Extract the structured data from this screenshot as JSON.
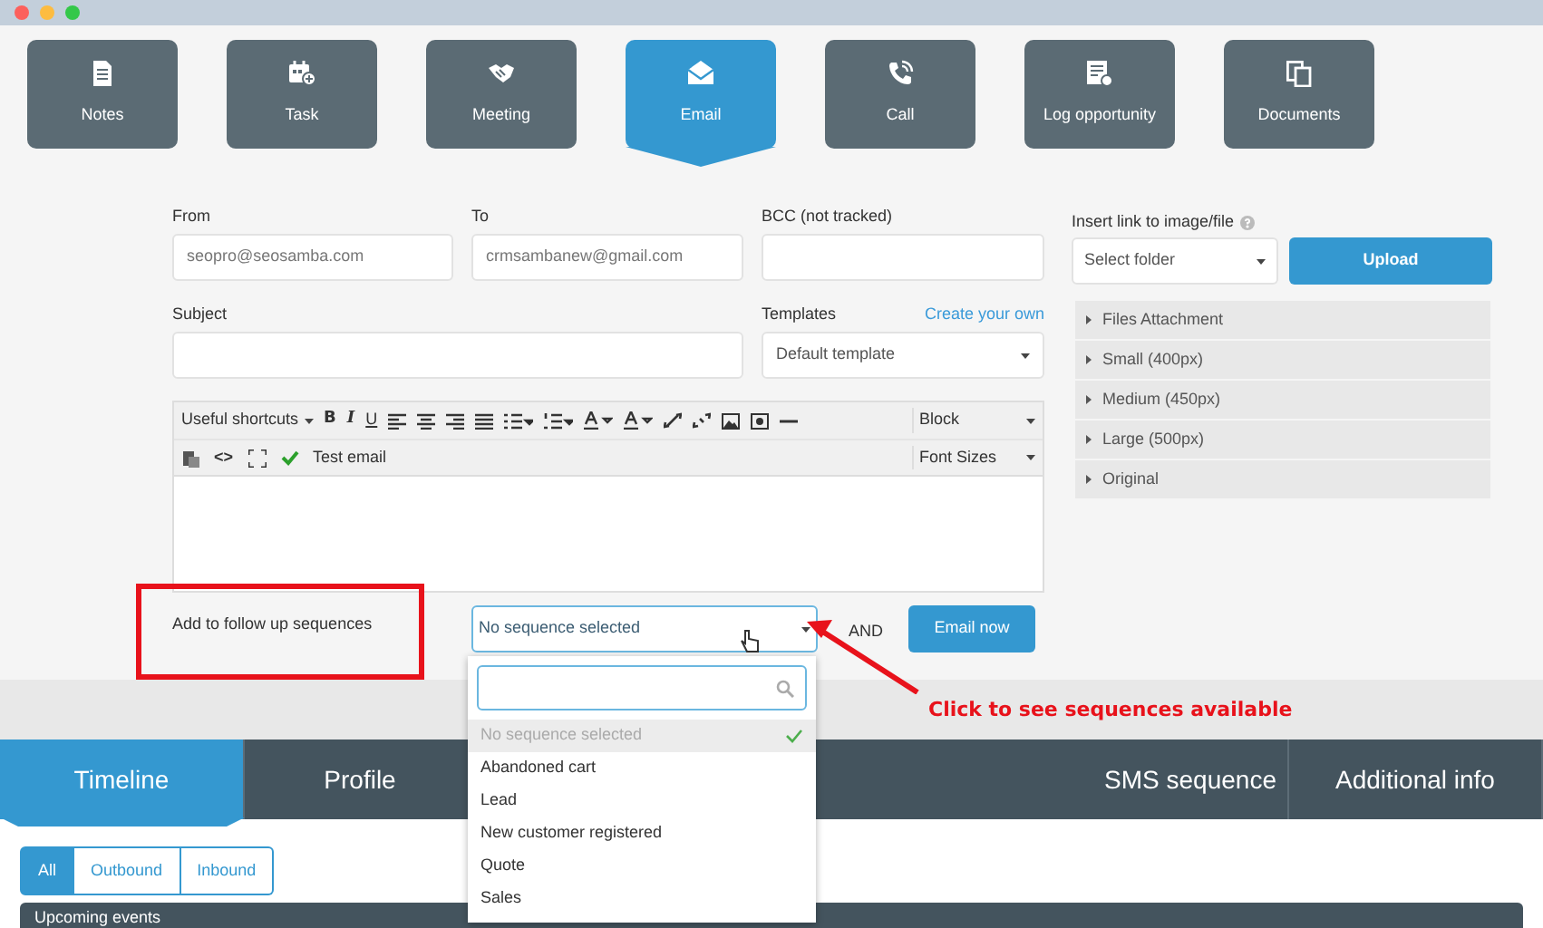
{
  "activity_tabs": [
    {
      "label": "Notes",
      "kind": "notes",
      "selected": false
    },
    {
      "label": "Task",
      "kind": "task",
      "selected": false
    },
    {
      "label": "Meeting",
      "kind": "meeting",
      "selected": false
    },
    {
      "label": "Email",
      "kind": "email",
      "selected": true
    },
    {
      "label": "Call",
      "kind": "call",
      "selected": false
    },
    {
      "label": "Log opportunity",
      "kind": "opportunity",
      "selected": false
    },
    {
      "label": "Documents",
      "kind": "documents",
      "selected": false
    }
  ],
  "email_form": {
    "from": {
      "label": "From",
      "value": "seopro@seosamba.com"
    },
    "to": {
      "label": "To",
      "value": "crmsambanew@gmail.com"
    },
    "bcc": {
      "label": "BCC (not tracked)"
    },
    "subject": {
      "label": "Subject"
    },
    "templates": {
      "label": "Templates",
      "link": "Create your own",
      "value": "Default template"
    },
    "toolbar": {
      "format_buttons": [
        "B",
        "I",
        "U"
      ],
      "source_button": "<>",
      "shortcuts": "Useful shortcuts",
      "block": "Block",
      "test_email": "Test email",
      "font_sizes": "Font Sizes"
    }
  },
  "sequences": {
    "label": "Add to follow up sequences",
    "value": "No sequence selected",
    "and_label": "AND",
    "send_button": "Email now",
    "options": [
      {
        "label": "No sequence selected",
        "selected": true
      },
      {
        "label": "Abandoned cart",
        "selected": false
      },
      {
        "label": "Lead",
        "selected": false
      },
      {
        "label": "New customer registered",
        "selected": false
      },
      {
        "label": "Quote",
        "selected": false
      },
      {
        "label": "Sales",
        "selected": false
      }
    ]
  },
  "attachments": {
    "label": "Insert link to image/file",
    "folder_select": "Select folder",
    "upload_button": "Upload",
    "sections": [
      {
        "label": "Files Attachment",
        "expanded": false
      },
      {
        "label": "Small (400px)",
        "expanded": false
      },
      {
        "label": "Medium (450px)",
        "expanded": false
      },
      {
        "label": "Large (500px)",
        "expanded": false
      },
      {
        "label": "Original",
        "expanded": false
      }
    ]
  },
  "annotation": {
    "text": "Click to see sequences available"
  },
  "profile_tabs": [
    {
      "label": "Timeline",
      "selected": true
    },
    {
      "label": "Profile",
      "selected": false
    },
    {
      "label": "SMS sequence",
      "selected": false
    },
    {
      "label": "Additional info",
      "selected": false
    }
  ],
  "filters": [
    {
      "label": "All",
      "selected": true
    },
    {
      "label": "Outbound",
      "selected": false
    },
    {
      "label": "Inbound",
      "selected": false
    }
  ],
  "events_header": "Upcoming events"
}
